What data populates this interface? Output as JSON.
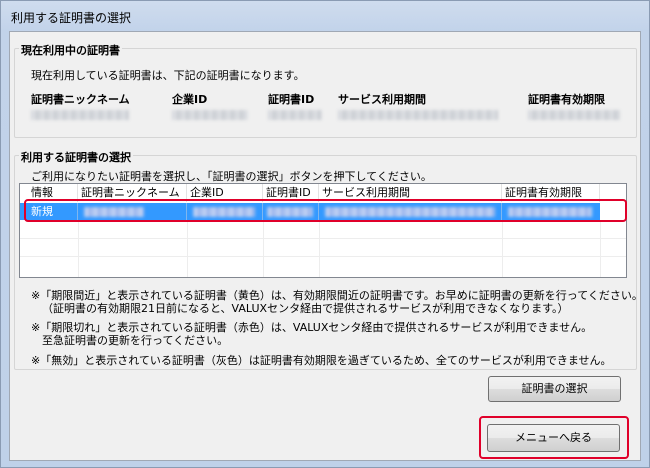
{
  "window": {
    "title": "利用する証明書の選択"
  },
  "current": {
    "group_title": "現在利用中の証明書",
    "description": "現在利用している証明書は、下記の証明書になります。",
    "headers": [
      "証明書ニックネーム",
      "企業ID",
      "証明書ID",
      "サービス利用期間",
      "証明書有効期限"
    ]
  },
  "select": {
    "group_title": "利用する証明書の選択",
    "description": "ご利用になりたい証明書を選択し、「証明書の選択」ボタンを押下してください。",
    "columns": [
      "情報",
      "証明書ニックネーム",
      "企業ID",
      "証明書ID",
      "サービス利用期間",
      "証明書有効期限"
    ],
    "rows": [
      {
        "info": "新規"
      }
    ]
  },
  "notes": {
    "n1_line1": "※「期限間近」と表示されている証明書（黄色）は、有効期限間近の証明書です。お早めに証明書の更新を行ってください。",
    "n1_line2": "（証明書の有効期限21日前になると、VALUXセンタ経由で提供されるサービスが利用できなくなります。）",
    "n2_line1": "※「期限切れ」と表示されている証明書（赤色）は、VALUXセンタ経由で提供されるサービスが利用できません。",
    "n2_line2": "至急証明書の更新を行ってください。",
    "n3_line1": "※「無効」と表示されている証明書（灰色）は証明書有効期限を過ぎているため、全てのサービスが利用できません。"
  },
  "buttons": {
    "select_cert": "証明書の選択",
    "back_to_menu": "メニューへ戻る"
  },
  "colors": {
    "highlight": "#e0002a",
    "selection": "#3399ff"
  }
}
